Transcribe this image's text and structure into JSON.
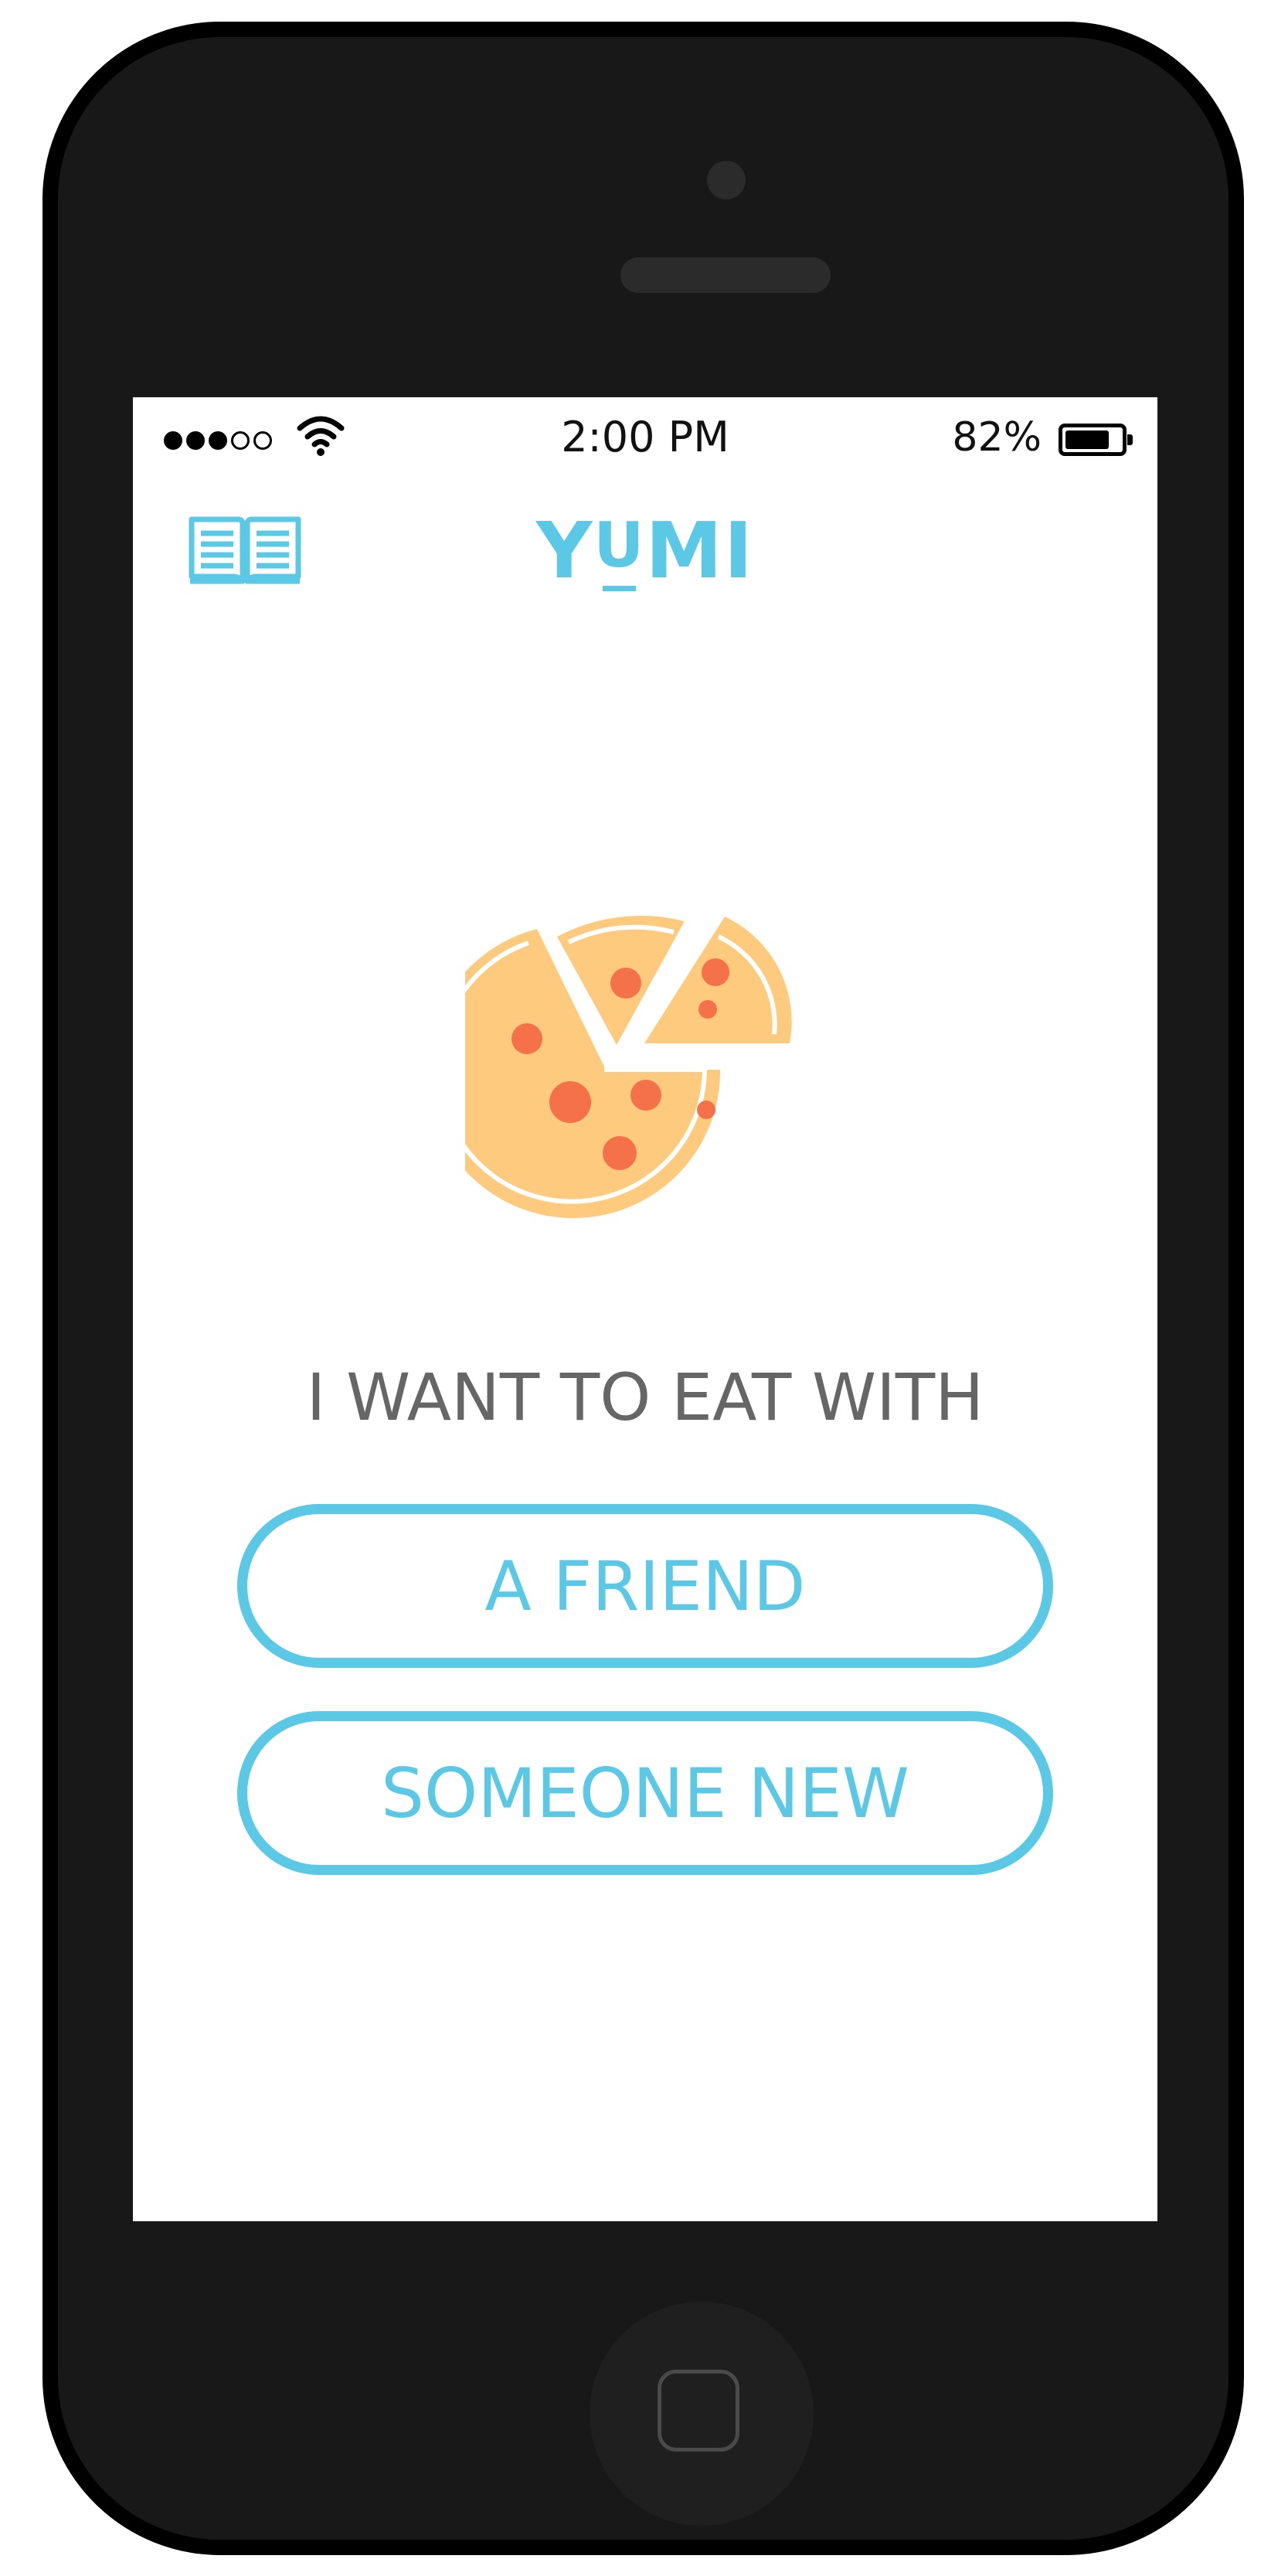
{
  "status_bar": {
    "time": "2:00 PM",
    "battery_percent": "82%",
    "battery_level": 0.82,
    "signal_bars_filled": 3,
    "signal_bars_total": 5
  },
  "header": {
    "menu_icon": "open-book-icon",
    "title_left": "Y",
    "title_middle": "U",
    "title_right": "MI"
  },
  "hero": {
    "icon": "pizza-icon"
  },
  "prompt": "I WANT TO EAT WITH",
  "buttons": {
    "friend": "A FRIEND",
    "someone_new": "SOMEONE NEW"
  },
  "colors": {
    "accent": "#5bc8e6",
    "prompt_text": "#666666",
    "pizza_crust": "#fecb7e",
    "pizza_topping": "#f4714a",
    "phone_body": "#181818"
  }
}
